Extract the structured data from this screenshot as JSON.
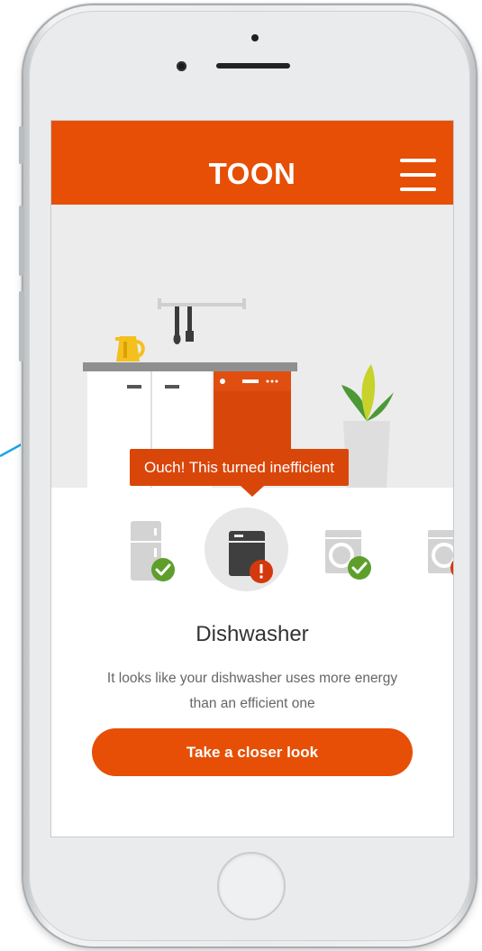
{
  "header": {
    "brand": "TOON",
    "menu_icon": "hamburger-menu-icon"
  },
  "alert": {
    "tooltip_text": "Ouch! This turned inefficient"
  },
  "appliances": [
    {
      "name": "fridge",
      "icon": "fridge-icon",
      "status": "ok",
      "status_icon": "check-icon"
    },
    {
      "name": "dishwasher",
      "icon": "dishwasher-icon",
      "status": "inefficient",
      "status_icon": "exclamation-icon",
      "selected": true
    },
    {
      "name": "washing machine",
      "icon": "washing-machine-icon",
      "status": "ok",
      "status_icon": "check-icon"
    },
    {
      "name": "dryer",
      "icon": "dryer-icon",
      "status": "inefficient",
      "status_icon": "exclamation-icon"
    }
  ],
  "detail": {
    "title": "Dishwasher",
    "description": "It looks like your dishwasher uses more energy than an efficient one",
    "cta_label": "Take a closer look"
  },
  "colors": {
    "brand_orange": "#e64f05",
    "alert_red": "#d9460a",
    "ok_green": "#5e9f2c",
    "warn_red": "#d4380d",
    "scene_bg": "#ececed"
  }
}
